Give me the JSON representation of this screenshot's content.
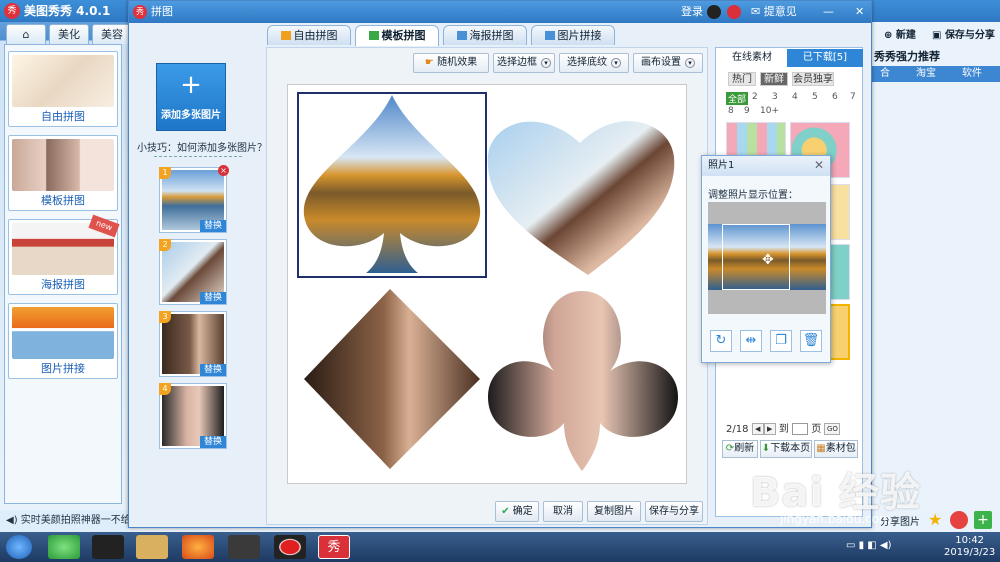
{
  "main_app": {
    "title": "美图秀秀 4.0.1",
    "logo_text": "秀",
    "tabs": [
      "⌂",
      "美化",
      "美容"
    ],
    "left_cards": [
      {
        "label": "自由拼图"
      },
      {
        "label": "模板拼图"
      },
      {
        "label": "海报拼图",
        "badge": "new"
      },
      {
        "label": "图片拼接"
      }
    ],
    "bottom_bar_text": "实时美颜拍照神器一不给图",
    "right_new": "新建",
    "right_save": "保存与分享",
    "right_recommend": "秀秀强力推荐",
    "right_bar_items": [
      "合",
      "淘宝",
      "软件"
    ],
    "share_pic": "分享图片"
  },
  "window": {
    "title": "拼图",
    "title_buttons": [
      "登录",
      "提意见"
    ],
    "tabs": [
      "自由拼图",
      "模板拼图",
      "海报拼图",
      "图片拼接"
    ],
    "active_tab": 1,
    "add_button_label": "添加多张图片",
    "tip_text": "小技巧：如何添加多张图片？",
    "slots": [
      {
        "num": "1",
        "replace": "替换",
        "deletable": true
      },
      {
        "num": "2",
        "replace": "替换"
      },
      {
        "num": "3",
        "replace": "替换"
      },
      {
        "num": "4",
        "replace": "替换"
      }
    ],
    "toolbar": {
      "random": "随机效果",
      "border": "选择边框",
      "texture": "选择底纹",
      "canvas": "画布设置"
    },
    "bottom_buttons": {
      "ok": "确定",
      "cancel": "取消",
      "copy": "复制图片",
      "save": "保存与分享"
    }
  },
  "material_panel": {
    "tabs": [
      "在线素材",
      "已下载[5]"
    ],
    "categories": [
      "热门",
      "新鲜",
      "会员独享"
    ],
    "selected_category": "新鲜",
    "page_filters": [
      "全部",
      "2",
      "3",
      "4",
      "5",
      "6",
      "7",
      "8",
      "9",
      "10+"
    ],
    "pager": {
      "current": "2/18",
      "goto_label": "到",
      "page_label": "页",
      "go": "GO"
    },
    "buttons": [
      "刷新",
      "下载本页",
      "素材包"
    ]
  },
  "photo_popup": {
    "title": "照片1",
    "label": "调整照片显示位置：",
    "tools": [
      "rotate-icon",
      "flip-icon",
      "copy-icon",
      "delete-icon"
    ]
  },
  "taskbar": {
    "time": "10:42",
    "date": "2019/3/23"
  },
  "watermark": {
    "brand": "Bai 经验",
    "url": "jingyan.baidu.com"
  }
}
